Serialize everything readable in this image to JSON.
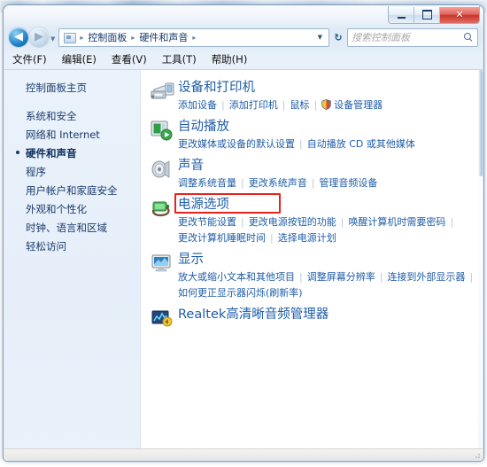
{
  "window": {
    "minimize_label": "最小化",
    "maximize_label": "最大化",
    "close_label": "关闭"
  },
  "navbar": {
    "back_glyph": "◀",
    "forward_glyph": "▶",
    "history_glyph": "▼",
    "breadcrumbs": [
      "控制面板",
      "硬件和声音"
    ],
    "crumb_separator": "▸",
    "dropdown_glyph": "▼",
    "refresh_glyph": "↻",
    "search_placeholder": "搜索控制面板"
  },
  "menubar": {
    "items": [
      "文件(F)",
      "编辑(E)",
      "查看(V)",
      "工具(T)",
      "帮助(H)"
    ]
  },
  "sidebar": {
    "home_label": "控制面板主页",
    "items": [
      {
        "label": "系统和安全",
        "current": false
      },
      {
        "label": "网络和 Internet",
        "current": false
      },
      {
        "label": "硬件和声音",
        "current": true
      },
      {
        "label": "程序",
        "current": false
      },
      {
        "label": "用户帐户和家庭安全",
        "current": false
      },
      {
        "label": "外观和个性化",
        "current": false
      },
      {
        "label": "时钟、语言和区域",
        "current": false
      },
      {
        "label": "轻松访问",
        "current": false
      }
    ]
  },
  "main": {
    "categories": [
      {
        "icon": "devices-and-printers-icon",
        "title": "设备和打印机",
        "link_rows": [
          [
            {
              "text": "添加设备",
              "shield": false
            },
            {
              "text": "添加打印机",
              "shield": false
            },
            {
              "text": "鼠标",
              "shield": false
            },
            {
              "text": "设备管理器",
              "shield": true
            }
          ]
        ],
        "highlighted": false
      },
      {
        "icon": "autoplay-icon",
        "title": "自动播放",
        "link_rows": [
          [
            {
              "text": "更改媒体或设备的默认设置",
              "shield": false
            },
            {
              "text": "自动播放 CD 或其他媒体",
              "shield": false
            }
          ]
        ],
        "highlighted": false
      },
      {
        "icon": "sound-icon",
        "title": "声音",
        "link_rows": [
          [
            {
              "text": "调整系统音量",
              "shield": false
            },
            {
              "text": "更改系统声音",
              "shield": false
            },
            {
              "text": "管理音频设备",
              "shield": false
            }
          ]
        ],
        "highlighted": false
      },
      {
        "icon": "power-options-icon",
        "title": "电源选项",
        "link_rows": [
          [
            {
              "text": "更改节能设置",
              "shield": false
            },
            {
              "text": "更改电源按钮的功能",
              "shield": false
            },
            {
              "text": "唤醒计算机时需要密码",
              "shield": false
            }
          ],
          [
            {
              "text": "更改计算机睡眠时间",
              "shield": false
            },
            {
              "text": "选择电源计划",
              "shield": false
            }
          ]
        ],
        "highlighted": true
      },
      {
        "icon": "display-icon",
        "title": "显示",
        "link_rows": [
          [
            {
              "text": "放大或缩小文本和其他项目",
              "shield": false
            },
            {
              "text": "调整屏幕分辨率",
              "shield": false
            },
            {
              "text": "连接到外部显示器",
              "shield": false
            }
          ],
          [
            {
              "text": "如何更正显示器闪烁(刷新率)",
              "shield": false
            }
          ]
        ],
        "highlighted": false
      },
      {
        "icon": "realtek-audio-manager-icon",
        "title": "Realtek高清晰音频管理器",
        "link_rows": [],
        "highlighted": false
      }
    ]
  },
  "colors": {
    "link": "#1f5da8",
    "annotation": "#e8221c",
    "sidebar_bg": "#e8f1fb"
  }
}
